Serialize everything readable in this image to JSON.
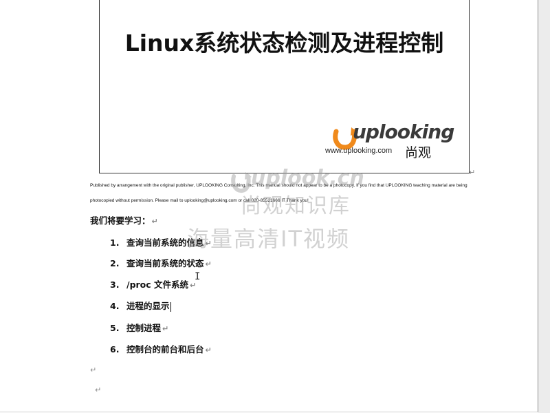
{
  "cover": {
    "title": "Linux系统状态检测及进程控制",
    "logo_text": "uplooking",
    "logo_url": "www.uplooking.com",
    "logo_cn": "尚观"
  },
  "fine_print": {
    "line1": "Published by arrangement with the original publisher, UPLOOKING Consulting, Inc. This manual should not appear to be a photocopy. If you find that UPLOOKING teaching material are being",
    "line2": "photocopied without permission. Please mail to uplooking@uplooking.com or call 020-85521666 IT Thank you!"
  },
  "intro": "我们将要学习：",
  "items": [
    {
      "num": "1.",
      "text": "查询当前系统的信息"
    },
    {
      "num": "2.",
      "text": "查询当前系统的状态"
    },
    {
      "num": "3.",
      "text": "/proc 文件系统"
    },
    {
      "num": "4.",
      "text": "进程的显示"
    },
    {
      "num": "5.",
      "text": "控制进程"
    },
    {
      "num": "6.",
      "text": "控制台的前台和后台"
    }
  ],
  "paragraph_mark": "↵",
  "watermark": {
    "line1": "uplook.cn",
    "line2": "尚观知识库",
    "line3": "海量高清IT视频"
  },
  "colors": {
    "logo_orange": "#f08a1c",
    "text": "#111111",
    "watermark": "#9b9b9b"
  }
}
